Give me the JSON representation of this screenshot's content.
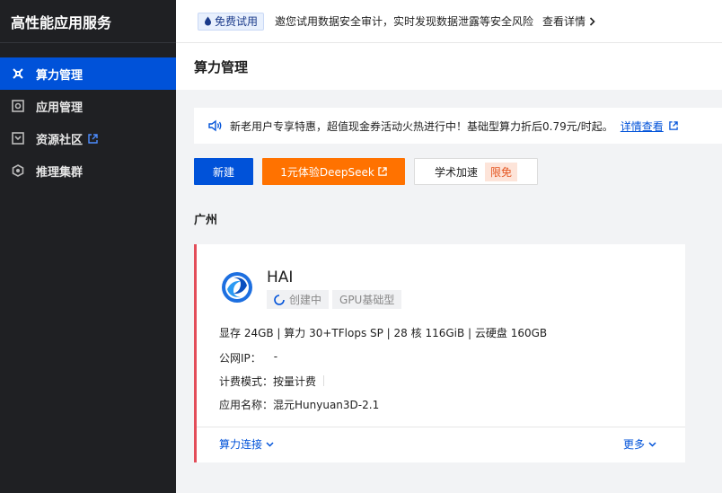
{
  "app": {
    "title": "高性能应用服务"
  },
  "sidebar": {
    "items": [
      {
        "label": "算力管理",
        "icon": "compute-icon",
        "active": true
      },
      {
        "label": "应用管理",
        "icon": "app-icon",
        "active": false
      },
      {
        "label": "资源社区",
        "icon": "community-icon",
        "active": false,
        "external": true
      },
      {
        "label": "推理集群",
        "icon": "cluster-icon",
        "active": false
      }
    ]
  },
  "topbar": {
    "badge": "免费试用",
    "text": "邀您试用数据安全审计，实时发现数据泄露等安全风险",
    "link": "查看详情"
  },
  "page": {
    "title": "算力管理"
  },
  "notice": {
    "text": "新老用户专享特惠，超值现金券活动火热进行中！基础型算力折后0.79元/时起。",
    "link": "详情查看"
  },
  "actions": {
    "new_label": "新建",
    "deepseek_label": "1元体验DeepSeek",
    "academic_label": "学术加速",
    "free_tag": "限免"
  },
  "region": "广州",
  "instance": {
    "name": "HAI",
    "status": "创建中",
    "type": "GPU基础型",
    "specs": "显存 24GB | 算力 30+TFlops SP | 28 核 116GiB | 云硬盘 160GB",
    "public_ip_label": "公网IP：",
    "public_ip_value": "-",
    "billing_label": "计费模式：",
    "billing_value": "按量计费",
    "app_label": "应用名称：",
    "app_value": "混元Hunyuan3D-2.1",
    "connect_label": "算力连接",
    "more_label": "更多"
  },
  "colors": {
    "primary": "#0052d9",
    "orange": "#ff7200",
    "danger": "#e34d59",
    "sidebar_bg": "#1f2023"
  }
}
